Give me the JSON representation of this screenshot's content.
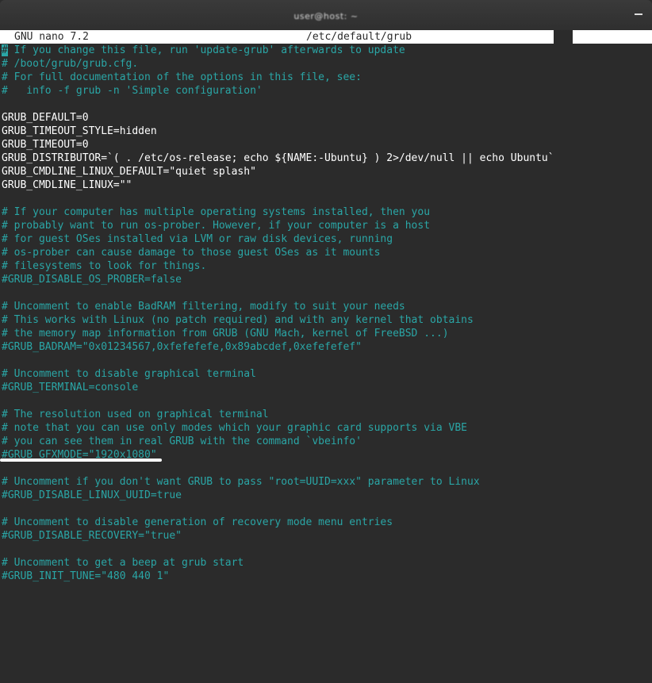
{
  "window": {
    "title": "user@host: ~",
    "close_icon": "minimize-icon"
  },
  "nano": {
    "version_label": "GNU nano 7.2",
    "filename": "/etc/default/grub"
  },
  "colors": {
    "comment": "#2aa6a6",
    "code": "#ffffff",
    "background": "#2b2b2b",
    "header_bg": "#ffffff"
  },
  "lines": [
    {
      "type": "comment",
      "text": "# If you change this file, run 'update-grub' afterwards to update"
    },
    {
      "type": "comment",
      "text": "# /boot/grub/grub.cfg."
    },
    {
      "type": "comment",
      "text": "# For full documentation of the options in this file, see:"
    },
    {
      "type": "comment",
      "text": "#   info -f grub -n 'Simple configuration'"
    },
    {
      "type": "blank",
      "text": ""
    },
    {
      "type": "code",
      "text": "GRUB_DEFAULT=0"
    },
    {
      "type": "code",
      "text": "GRUB_TIMEOUT_STYLE=hidden"
    },
    {
      "type": "code",
      "text": "GRUB_TIMEOUT=0"
    },
    {
      "type": "code",
      "text": "GRUB_DISTRIBUTOR=`( . /etc/os-release; echo ${NAME:-Ubuntu} ) 2>/dev/null || echo Ubuntu`"
    },
    {
      "type": "code",
      "text": "GRUB_CMDLINE_LINUX_DEFAULT=\"quiet splash\""
    },
    {
      "type": "code",
      "text": "GRUB_CMDLINE_LINUX=\"\""
    },
    {
      "type": "blank",
      "text": ""
    },
    {
      "type": "comment",
      "text": "# If your computer has multiple operating systems installed, then you"
    },
    {
      "type": "comment",
      "text": "# probably want to run os-prober. However, if your computer is a host"
    },
    {
      "type": "comment",
      "text": "# for guest OSes installed via LVM or raw disk devices, running"
    },
    {
      "type": "comment",
      "text": "# os-prober can cause damage to those guest OSes as it mounts"
    },
    {
      "type": "comment",
      "text": "# filesystems to look for things."
    },
    {
      "type": "comment",
      "text": "#GRUB_DISABLE_OS_PROBER=false"
    },
    {
      "type": "blank",
      "text": ""
    },
    {
      "type": "comment",
      "text": "# Uncomment to enable BadRAM filtering, modify to suit your needs"
    },
    {
      "type": "comment",
      "text": "# This works with Linux (no patch required) and with any kernel that obtains"
    },
    {
      "type": "comment",
      "text": "# the memory map information from GRUB (GNU Mach, kernel of FreeBSD ...)"
    },
    {
      "type": "comment",
      "text": "#GRUB_BADRAM=\"0x01234567,0xfefefefe,0x89abcdef,0xefefefef\""
    },
    {
      "type": "blank",
      "text": ""
    },
    {
      "type": "comment",
      "text": "# Uncomment to disable graphical terminal"
    },
    {
      "type": "comment",
      "text": "#GRUB_TERMINAL=console"
    },
    {
      "type": "blank",
      "text": ""
    },
    {
      "type": "comment",
      "text": "# The resolution used on graphical terminal"
    },
    {
      "type": "comment",
      "text": "# note that you can use only modes which your graphic card supports via VBE"
    },
    {
      "type": "comment",
      "text": "# you can see them in real GRUB with the command `vbeinfo'"
    },
    {
      "type": "comment",
      "text": "#GRUB_GFXMODE=\"1920x1080\""
    },
    {
      "type": "blank",
      "text": ""
    },
    {
      "type": "comment",
      "text": "# Uncomment if you don't want GRUB to pass \"root=UUID=xxx\" parameter to Linux"
    },
    {
      "type": "comment",
      "text": "#GRUB_DISABLE_LINUX_UUID=true"
    },
    {
      "type": "blank",
      "text": ""
    },
    {
      "type": "comment",
      "text": "# Uncomment to disable generation of recovery mode menu entries"
    },
    {
      "type": "comment",
      "text": "#GRUB_DISABLE_RECOVERY=\"true\""
    },
    {
      "type": "blank",
      "text": ""
    },
    {
      "type": "comment",
      "text": "# Uncomment to get a beep at grub start"
    },
    {
      "type": "comment",
      "text": "#GRUB_INIT_TUNE=\"480 440 1\""
    }
  ]
}
